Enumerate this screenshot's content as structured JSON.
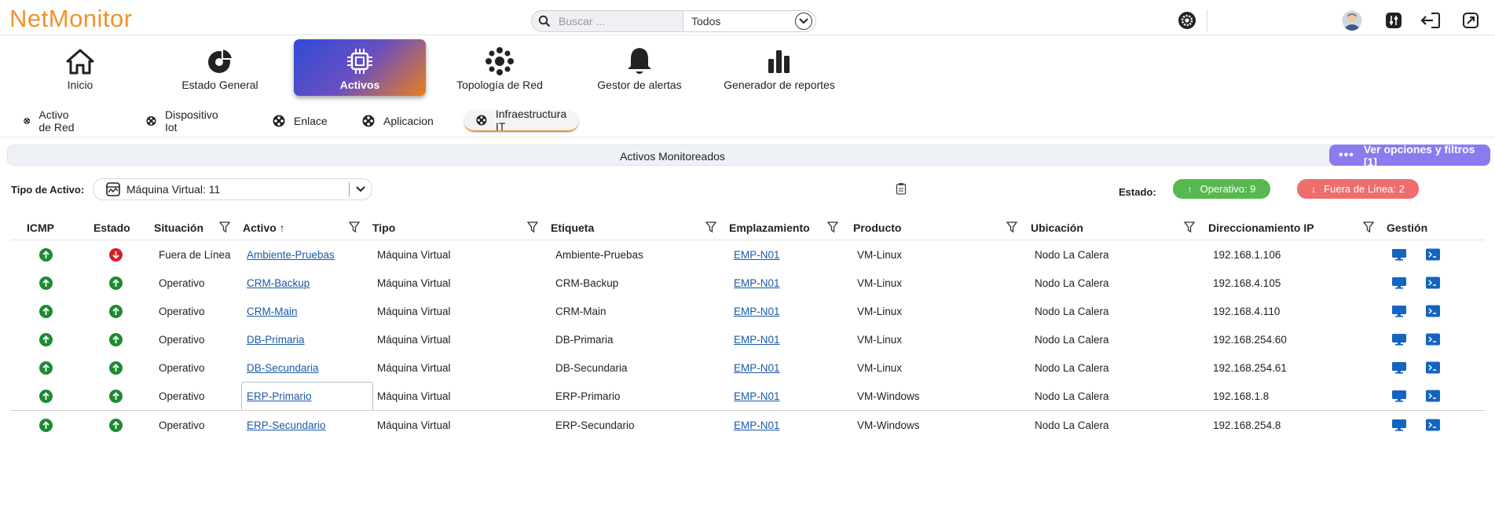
{
  "app": {
    "logo": "NetMonitor"
  },
  "search": {
    "placeholder": "Buscar ...",
    "scope_value": "Todos"
  },
  "header_icons": [
    "settings-icon",
    "user-avatar-icon",
    "tune-icon",
    "logout-icon",
    "fullscreen-icon"
  ],
  "nav": {
    "items": [
      {
        "label": "Inicio",
        "icon": "home-icon"
      },
      {
        "label": "Estado General",
        "icon": "donut-chart-icon"
      },
      {
        "label": "Activos",
        "icon": "chip-icon",
        "active": true
      },
      {
        "label": "Topología de Red",
        "icon": "network-icon"
      },
      {
        "label": "Gestor de alertas",
        "icon": "bell-icon"
      },
      {
        "label": "Generador de reportes",
        "icon": "bar-chart-icon"
      }
    ]
  },
  "subtabs": [
    {
      "label": "Activo de Red"
    },
    {
      "label": "Dispositivo Iot"
    },
    {
      "label": "Enlace"
    },
    {
      "label": "Aplicacion"
    },
    {
      "label": "Infraestructura IT",
      "active": true
    }
  ],
  "section": {
    "title": "Activos Monitoreados",
    "filters_button": "Ver opciones y filtros [1]"
  },
  "filter": {
    "type_label": "Tipo de Activo:",
    "type_value": "Máquina Virtual: 11",
    "estado_label": "Estado:",
    "operativo": "Operativo: 9",
    "fuera": "Fuera de Línea: 2"
  },
  "colors": {
    "accent": "#f0932b",
    "primary": "#2f4bd8",
    "ok": "#1e8a33",
    "down": "#d71f23",
    "filters": "#8b7bf0"
  },
  "table": {
    "columns": [
      "ICMP",
      "Estado",
      "Situación",
      "Activo ↑",
      "Tipo",
      "Etiqueta",
      "Emplazamiento",
      "Producto",
      "Ubicación",
      "Direccionamiento IP",
      "Gestión"
    ],
    "rows": [
      {
        "icmp": "up",
        "estado": "down",
        "situacion": "Fuera de Línea",
        "activo": "Ambiente-Pruebas",
        "tipo": "Máquina Virtual",
        "etiqueta": "Ambiente-Pruebas",
        "emplazamiento": "EMP-N01",
        "producto": "VM-Linux",
        "ubicacion": "Nodo La Calera",
        "ip": "192.168.1.106"
      },
      {
        "icmp": "up",
        "estado": "up",
        "situacion": "Operativo",
        "activo": "CRM-Backup",
        "tipo": "Máquina Virtual",
        "etiqueta": "CRM-Backup",
        "emplazamiento": "EMP-N01",
        "producto": "VM-Linux",
        "ubicacion": "Nodo La Calera",
        "ip": "192.168.4.105"
      },
      {
        "icmp": "up",
        "estado": "up",
        "situacion": "Operativo",
        "activo": "CRM-Main",
        "tipo": "Máquina Virtual",
        "etiqueta": "CRM-Main",
        "emplazamiento": "EMP-N01",
        "producto": "VM-Linux",
        "ubicacion": "Nodo La Calera",
        "ip": "192.168.4.110"
      },
      {
        "icmp": "up",
        "estado": "up",
        "situacion": "Operativo",
        "activo": "DB-Primaria",
        "tipo": "Máquina Virtual",
        "etiqueta": "DB-Primaria",
        "emplazamiento": "EMP-N01",
        "producto": "VM-Linux",
        "ubicacion": "Nodo La Calera",
        "ip": "192.168.254.60"
      },
      {
        "icmp": "up",
        "estado": "up",
        "situacion": "Operativo",
        "activo": "DB-Secundaria",
        "tipo": "Máquina Virtual",
        "etiqueta": "DB-Secundaria",
        "emplazamiento": "EMP-N01",
        "producto": "VM-Linux",
        "ubicacion": "Nodo La Calera",
        "ip": "192.168.254.61"
      },
      {
        "icmp": "up",
        "estado": "up",
        "situacion": "Operativo",
        "activo": "ERP-Primario",
        "tipo": "Máquina Virtual",
        "etiqueta": "ERP-Primario",
        "emplazamiento": "EMP-N01",
        "producto": "VM-Windows",
        "ubicacion": "Nodo La Calera",
        "ip": "192.168.1.8"
      },
      {
        "icmp": "up",
        "estado": "up",
        "situacion": "Operativo",
        "activo": "ERP-Secundario",
        "tipo": "Máquina Virtual",
        "etiqueta": "ERP-Secundario",
        "emplazamiento": "EMP-N01",
        "producto": "VM-Windows",
        "ubicacion": "Nodo La Calera",
        "ip": "192.168.254.8"
      }
    ]
  }
}
